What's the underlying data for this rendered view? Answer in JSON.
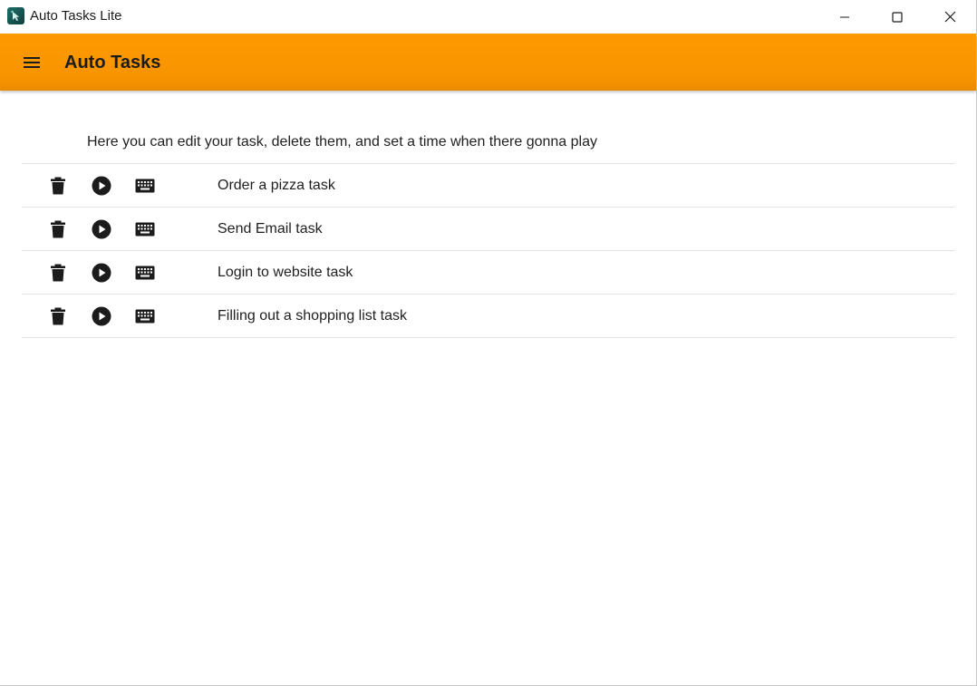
{
  "window": {
    "title": "Auto Tasks Lite",
    "app_icon": "cursor-hand-app-icon",
    "controls": [
      "minimize-icon",
      "maximize-icon",
      "close-icon"
    ]
  },
  "appbar": {
    "title": "Auto Tasks",
    "menu_icon": "hamburger-menu-icon",
    "color": "#ff9900"
  },
  "main": {
    "description": "Here you can edit your task, delete them, and set a time when there gonna play",
    "row_icons": [
      "delete-icon",
      "play-icon",
      "keyboard-icon"
    ],
    "tasks": [
      {
        "name": "Order a pizza task"
      },
      {
        "name": "Send Email task"
      },
      {
        "name": "Login to website task"
      },
      {
        "name": "Filling out a shopping list task"
      }
    ]
  }
}
